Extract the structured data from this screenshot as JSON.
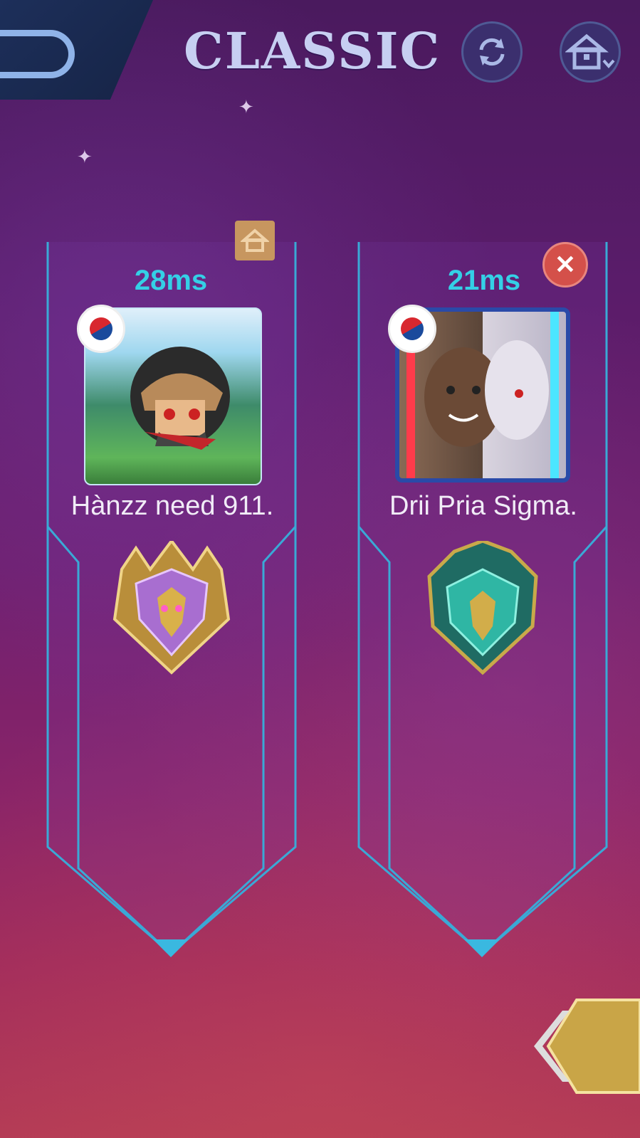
{
  "header": {
    "title": "CLASSIC",
    "back_icon": "back-arrow-icon",
    "refresh_icon": "refresh-icon",
    "home_icon": "home-icon"
  },
  "players": [
    {
      "ping": "28ms",
      "name": "Hànzz need 911.",
      "flag": "south-korea-flag-icon",
      "is_host": true,
      "rank_emblem": "mythic-rank-emblem"
    },
    {
      "ping": "21ms",
      "name": "Drii Pria Sigma.",
      "flag": "south-korea-flag-icon",
      "is_host": false,
      "rank_emblem": "mythical-honor-rank-emblem"
    }
  ],
  "colors": {
    "ping": "#34d0e6",
    "frame": "#3aa9d6",
    "title": "#c7cff2",
    "kick": "#d4504a",
    "host": "#c7965f"
  }
}
